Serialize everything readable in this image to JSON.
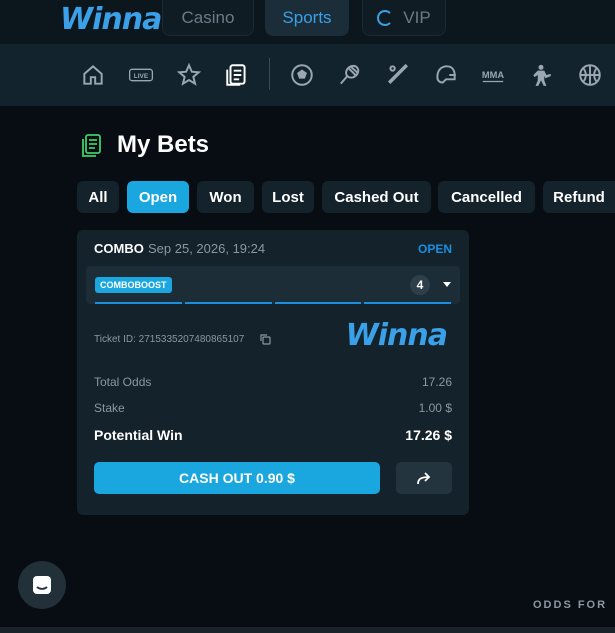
{
  "header": {
    "logo": "Winna",
    "tabs": [
      {
        "label": "Casino",
        "active": false
      },
      {
        "label": "Sports",
        "active": true
      },
      {
        "label": "VIP",
        "active": false
      }
    ]
  },
  "subnav": {
    "items": [
      "home-icon",
      "live-icon",
      "star-icon",
      "my-bets-icon",
      "soccer-icon",
      "tennis-icon",
      "baseball-icon",
      "american-football-icon",
      "mma-icon",
      "esports-icon",
      "basketball-icon"
    ],
    "live_label": "LIVE",
    "mma_label": "MMA"
  },
  "page": {
    "title": "My Bets"
  },
  "filters": [
    "All",
    "Open",
    "Won",
    "Lost",
    "Cashed Out",
    "Cancelled",
    "Refund"
  ],
  "active_filter": "Open",
  "bet": {
    "type": "COMBO",
    "date": "Sep 25, 2026, 19:24",
    "status": "OPEN",
    "boost_label": "COMBOBOOST",
    "selections": "4",
    "ticket_label": "Ticket ID:",
    "ticket_id": "2715335207480865107",
    "logo": "Winna",
    "total_odds_label": "Total Odds",
    "total_odds": "17.26",
    "stake_label": "Stake",
    "stake": "1.00 $",
    "potential_win_label": "Potential Win",
    "potential_win": "17.26 $",
    "cashout_label": "CASH OUT 0.90 $"
  },
  "footer": {
    "text": "ODDS FOR"
  },
  "colors": {
    "accent": "#1aa7e0",
    "background": "#070d12",
    "card": "#14222b"
  }
}
